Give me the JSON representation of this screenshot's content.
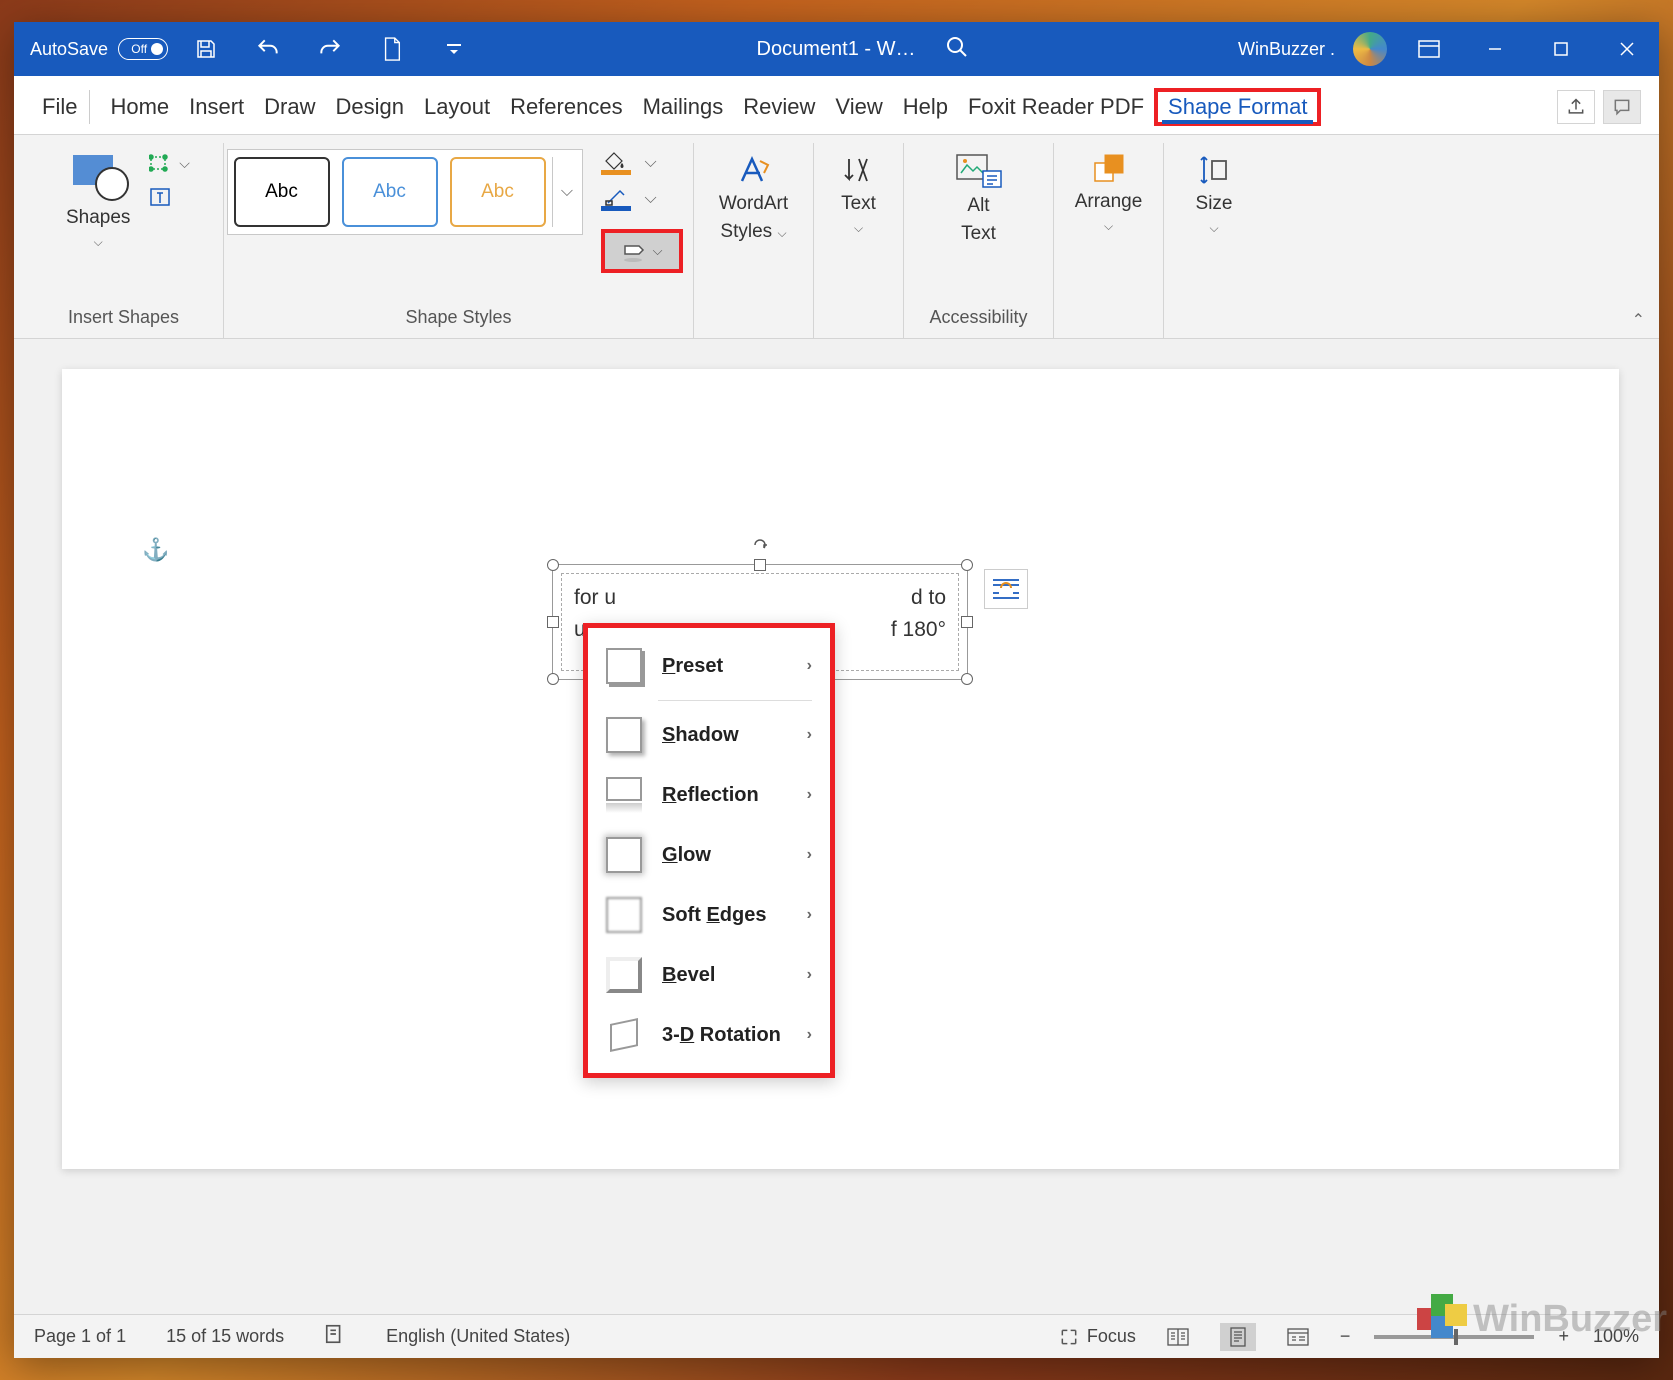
{
  "titlebar": {
    "autosave_label": "AutoSave",
    "autosave_state": "Off",
    "document_title": "Document1  -  W…",
    "user_name": "WinBuzzer ."
  },
  "tabs": {
    "file": "File",
    "home": "Home",
    "insert": "Insert",
    "draw": "Draw",
    "design": "Design",
    "layout": "Layout",
    "references": "References",
    "mailings": "Mailings",
    "review": "Review",
    "view": "View",
    "help": "Help",
    "foxit": "Foxit Reader PDF",
    "shape_format": "Shape Format"
  },
  "ribbon": {
    "shapes_label": "Shapes",
    "insert_shapes_group": "Insert Shapes",
    "shape_styles_group": "Shape Styles",
    "gallery_abc": "Abc",
    "wordart_label": "WordArt",
    "wordart_styles": "Styles",
    "text_label": "Text",
    "alt_text_label": "Alt",
    "alt_text_label2": "Text",
    "accessibility_group": "Accessibility",
    "arrange_label": "Arrange",
    "size_label": "Size"
  },
  "effects_menu": {
    "preset": "Preset",
    "shadow": "Shadow",
    "reflection": "Reflection",
    "glow": "Glow",
    "soft_edges": "Soft Edges",
    "bevel": "Bevel",
    "rotation": "3-D Rotation"
  },
  "document": {
    "line1_left": "for u",
    "line1_right": "d to",
    "line2_left": "use",
    "line2_right": "f 180°"
  },
  "statusbar": {
    "page": "Page 1 of 1",
    "words": "15 of 15 words",
    "language": "English (United States)",
    "focus": "Focus",
    "zoom": "100%"
  },
  "watermark": "WinBuzzer"
}
